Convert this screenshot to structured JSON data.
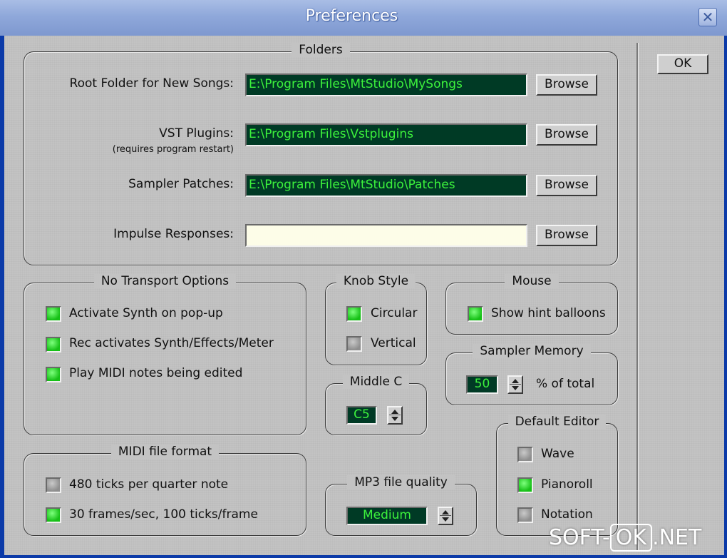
{
  "window": {
    "title": "Preferences",
    "close_glyph": "✕"
  },
  "ok_label": "OK",
  "folders": {
    "title": "Folders",
    "browse_label": "Browse",
    "rows": [
      {
        "label": "Root Folder for New Songs:",
        "sub": "",
        "value": "E:\\Program Files\\MtStudio\\MySongs"
      },
      {
        "label": "VST Plugins:",
        "sub": "(requires program restart)",
        "value": "E:\\Program Files\\Vstplugins"
      },
      {
        "label": "Sampler Patches:",
        "sub": "",
        "value": "E:\\Program Files\\MtStudio\\Patches"
      },
      {
        "label": "Impulse Responses:",
        "sub": "",
        "value": ""
      }
    ]
  },
  "no_transport": {
    "title": "No Transport Options",
    "options": [
      {
        "label": "Activate Synth on pop-up",
        "checked": true
      },
      {
        "label": "Rec activates Synth/Effects/Meter",
        "checked": true
      },
      {
        "label": "Play MIDI notes being edited",
        "checked": true
      }
    ]
  },
  "knob_style": {
    "title": "Knob Style",
    "options": [
      {
        "label": "Circular",
        "checked": true
      },
      {
        "label": "Vertical",
        "checked": false
      }
    ]
  },
  "mouse": {
    "title": "Mouse",
    "options": [
      {
        "label": "Show hint balloons",
        "checked": true
      }
    ]
  },
  "sampler_memory": {
    "title": "Sampler Memory",
    "value": "50",
    "unit": "% of total"
  },
  "middle_c": {
    "title": "Middle C",
    "value": "C5"
  },
  "midi_format": {
    "title": "MIDI file format",
    "options": [
      {
        "label": "480 ticks per quarter note",
        "checked": false
      },
      {
        "label": "30 frames/sec, 100 ticks/frame",
        "checked": true
      }
    ]
  },
  "mp3_quality": {
    "title": "MP3 file quality",
    "value": "Medium"
  },
  "default_editor": {
    "title": "Default Editor",
    "options": [
      {
        "label": "Wave",
        "checked": false
      },
      {
        "label": "Pianoroll",
        "checked": true
      },
      {
        "label": "Notation",
        "checked": false
      }
    ]
  },
  "watermark": {
    "left": "SOFT-",
    "box": "OK",
    "right": ".NET"
  },
  "colors": {
    "led_on": "#16c016",
    "led_off": "#8e8e8e",
    "path_text": "#3cf23c",
    "path_bg": "#003a25",
    "face": "#c3c3c3"
  }
}
